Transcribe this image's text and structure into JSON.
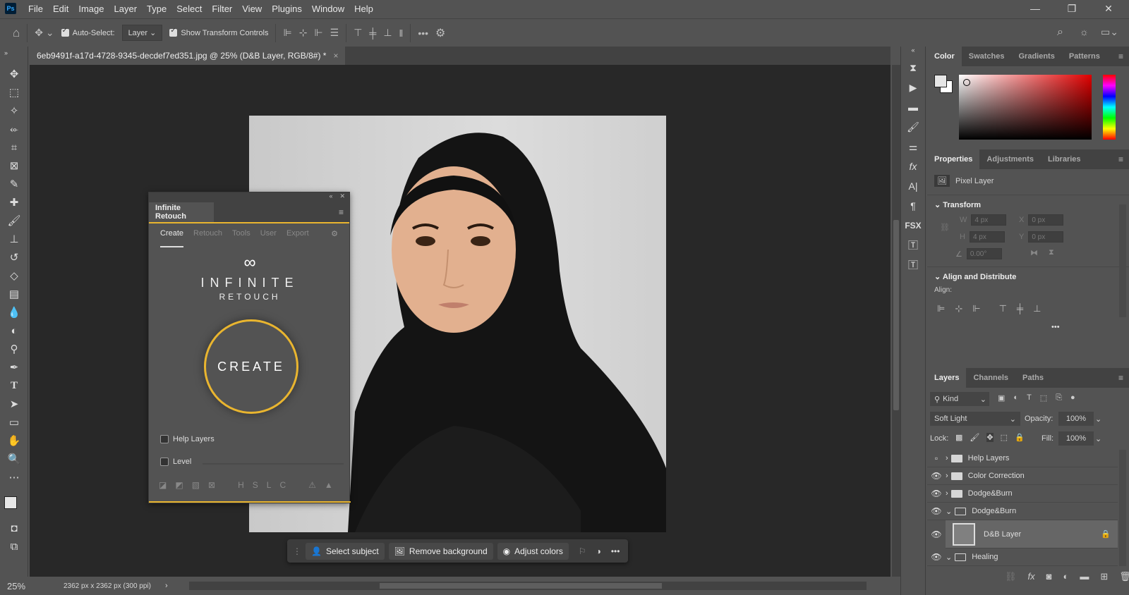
{
  "app": {
    "logo": "Ps",
    "menu": [
      "File",
      "Edit",
      "Image",
      "Layer",
      "Type",
      "Select",
      "Filter",
      "View",
      "Plugins",
      "Window",
      "Help"
    ]
  },
  "options": {
    "auto_select_label": "Auto-Select:",
    "auto_select_target": "Layer",
    "show_transform_label": "Show Transform Controls",
    "more": "•••"
  },
  "document": {
    "tab_title": "6eb9491f-a17d-4728-9345-decdef7ed351.jpg @ 25% (D&B Layer, RGB/8#) *",
    "close": "×",
    "zoom": "25%",
    "dimensions": "2362 px x 2362 px (300 ppi)"
  },
  "plugin": {
    "title": "Infinite Retouch",
    "tabs": [
      "Create",
      "Retouch",
      "Tools",
      "User",
      "Export"
    ],
    "logo_symbol": "∞",
    "logo_line1": "INFINITE",
    "logo_line2": "RETOUCH",
    "create_label": "CREATE",
    "help_layers_label": "Help Layers",
    "level_label": "Level",
    "bottom_letters": [
      "H",
      "S",
      "L",
      "C"
    ]
  },
  "taskbar": {
    "select_subject": "Select subject",
    "remove_background": "Remove background",
    "adjust_colors": "Adjust colors",
    "more": "•••"
  },
  "color_panel": {
    "tabs": [
      "Color",
      "Swatches",
      "Gradients",
      "Patterns"
    ],
    "accent": "#e9b52f"
  },
  "properties": {
    "tabs": [
      "Properties",
      "Adjustments",
      "Libraries"
    ],
    "layer_type": "Pixel Layer",
    "transform_label": "Transform",
    "w_label": "W",
    "w": "4 px",
    "h_label": "H",
    "h": "4 px",
    "x_label": "X",
    "x": "0 px",
    "y_label": "Y",
    "y": "0 px",
    "angle": "0.00°",
    "align_section": "Align and Distribute",
    "align_label": "Align:",
    "more": "•••"
  },
  "layers": {
    "tabs": [
      "Layers",
      "Channels",
      "Paths"
    ],
    "filter": "Kind",
    "blend_mode": "Soft Light",
    "opacity_label": "Opacity:",
    "opacity": "100%",
    "lock_label": "Lock:",
    "fill_label": "Fill:",
    "fill": "100%",
    "items": [
      {
        "name": "Help Layers",
        "visible": false,
        "expanded": false
      },
      {
        "name": "Color Correction",
        "visible": true,
        "expanded": false
      },
      {
        "name": "Dodge&Burn",
        "visible": true,
        "expanded": false
      },
      {
        "name": "Dodge&Burn",
        "visible": true,
        "expanded": true
      },
      {
        "name": "D&B Layer",
        "visible": true,
        "selected": true
      },
      {
        "name": "Healing",
        "visible": true,
        "expanded": true
      }
    ]
  }
}
